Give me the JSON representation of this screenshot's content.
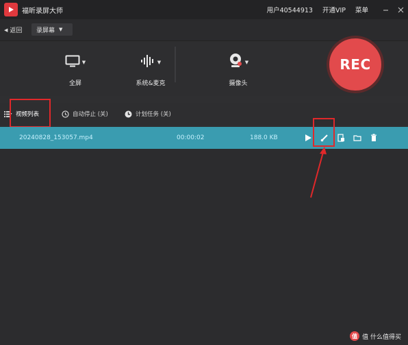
{
  "window": {
    "title": "福昕录屏大师",
    "user": "用户40544913",
    "vip": "开通VIP",
    "menu": "菜单"
  },
  "subbar": {
    "back_label": "返回",
    "mode": "录屏幕"
  },
  "sources": {
    "fullscreen": "全屏",
    "audio": "系统&麦克",
    "camera": "摄像头"
  },
  "rec_label": "REC",
  "tabs": {
    "video_list": "视频列表",
    "auto_stop": "自动停止 (关)",
    "schedule": "计划任务 (关)"
  },
  "files": [
    {
      "name": "20240828_153057.mp4",
      "duration": "00:00:02",
      "size": "188.0 KB"
    }
  ],
  "watermark": "值 什么值得买",
  "colors": {
    "accent_red": "#e24a4c",
    "row_highlight": "#3a9cb0",
    "annotation_red": "#e0282a"
  }
}
